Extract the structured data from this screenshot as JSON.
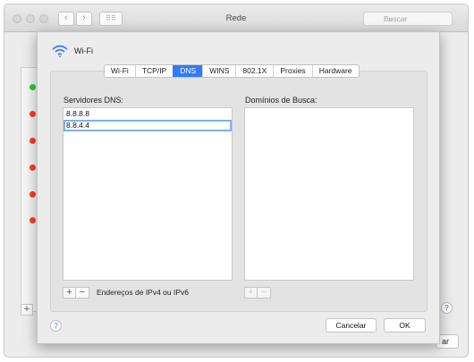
{
  "window": {
    "title": "Rede",
    "search_placeholder": "Buscar"
  },
  "background": {
    "help_label": "?",
    "button_fragment": "ar",
    "plus_label": "+"
  },
  "sheet": {
    "interface_name": "Wi-Fi",
    "tabs": [
      {
        "label": "Wi-Fi",
        "active": false
      },
      {
        "label": "TCP/IP",
        "active": false
      },
      {
        "label": "DNS",
        "active": true
      },
      {
        "label": "WINS",
        "active": false
      },
      {
        "label": "802.1X",
        "active": false
      },
      {
        "label": "Proxies",
        "active": false
      },
      {
        "label": "Hardware",
        "active": false
      }
    ],
    "dns_servers": {
      "label": "Servidores DNS:",
      "entries": [
        "8.8.8.8",
        "8.8.4.4"
      ],
      "hint": "Endereços de IPv4 ou IPv6"
    },
    "search_domains": {
      "label": "Domínios de Busca:",
      "entries": []
    },
    "buttons": {
      "help": "?",
      "cancel": "Cancelar",
      "ok": "OK"
    }
  }
}
